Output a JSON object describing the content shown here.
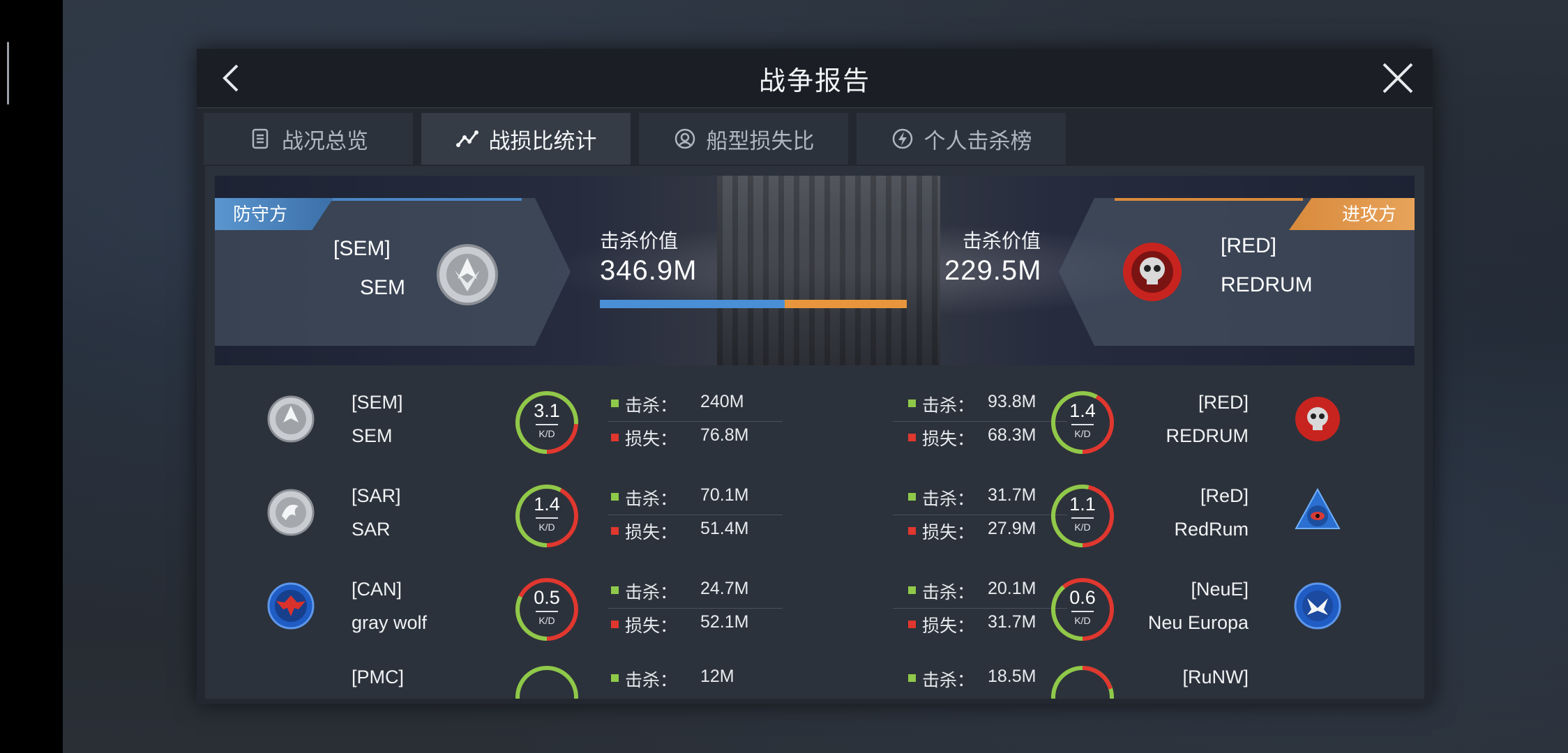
{
  "window": {
    "title": "战争报告"
  },
  "tabs": [
    {
      "label": "战况总览",
      "icon": "list-icon",
      "active": false
    },
    {
      "label": "战损比统计",
      "icon": "line-chart-icon",
      "active": true
    },
    {
      "label": "船型损失比",
      "icon": "target-icon",
      "active": false
    },
    {
      "label": "个人击杀榜",
      "icon": "lightning-icon",
      "active": false
    }
  ],
  "banner": {
    "defender": {
      "role": "防守方",
      "tag": "[SEM]",
      "name": "SEM",
      "kill_label": "击杀价值",
      "kill_value": "346.9M"
    },
    "attacker": {
      "role": "进攻方",
      "tag": "[RED]",
      "name": "REDRUM",
      "kill_label": "击杀价值",
      "kill_value": "229.5M"
    },
    "share": {
      "defender": 0.602,
      "attacker": 0.398
    }
  },
  "labels": {
    "kill": "击杀：",
    "loss": "损失：",
    "kd": "K/D"
  },
  "colors": {
    "kill": "#8fc94a",
    "loss": "#e0372f",
    "defender": "#4a8fd6",
    "attacker": "#e8963e"
  },
  "rows": [
    {
      "left": {
        "tag": "[SEM]",
        "name": "SEM",
        "kd": "3.1",
        "kill": "240M",
        "loss": "76.8M",
        "logo": "sem-emblem-icon"
      },
      "right": {
        "tag": "[RED]",
        "name": "REDRUM",
        "kd": "1.4",
        "kill": "93.8M",
        "loss": "68.3M",
        "logo": "redrum-skull-icon"
      }
    },
    {
      "left": {
        "tag": "[SAR]",
        "name": "SAR",
        "kd": "1.4",
        "kill": "70.1M",
        "loss": "51.4M",
        "logo": "sar-dragon-icon"
      },
      "right": {
        "tag": "[ReD]",
        "name": "RedRum",
        "kd": "1.1",
        "kill": "31.7M",
        "loss": "27.9M",
        "logo": "redrum-eye-icon"
      }
    },
    {
      "left": {
        "tag": "[CAN]",
        "name": "gray wolf",
        "kd": "0.5",
        "kill": "24.7M",
        "loss": "52.1M",
        "logo": "can-eagle-icon"
      },
      "right": {
        "tag": "[NeuE]",
        "name": "Neu Europa",
        "kd": "0.6",
        "kill": "20.1M",
        "loss": "31.7M",
        "logo": "neue-emblem-icon"
      }
    },
    {
      "left": {
        "tag": "[PMC]",
        "kill": "12M"
      },
      "right": {
        "tag": "[RuNW]",
        "kill": "18.5M"
      }
    }
  ]
}
